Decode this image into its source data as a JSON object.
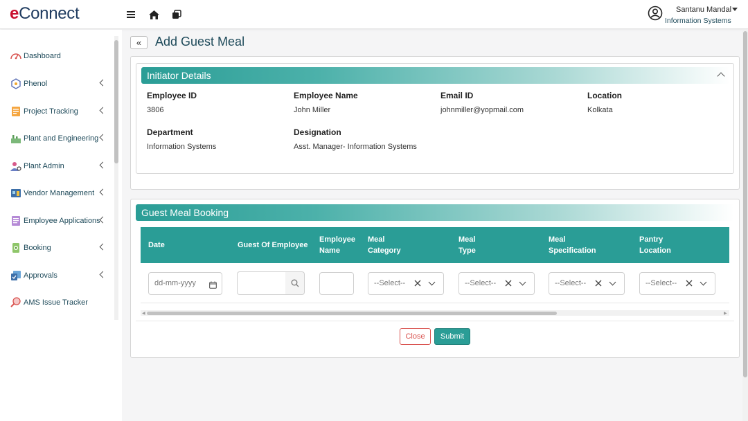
{
  "app": {
    "logo_e": "e",
    "logo_rest": "Connect"
  },
  "header": {
    "user_name": "Santanu Mandal",
    "user_dept": "Information Systems",
    "icons": [
      "menu-icon",
      "home-icon",
      "apps-icon",
      "user-circle-icon"
    ]
  },
  "sidebar": {
    "items": [
      {
        "label": "Dashboard",
        "icon": "dashboard-icon",
        "expandable": false
      },
      {
        "label": "Phenol",
        "icon": "phenol-icon",
        "expandable": true
      },
      {
        "label": "Project Tracking",
        "icon": "project-icon",
        "expandable": true
      },
      {
        "label": "Plant and Engineering",
        "icon": "plant-icon",
        "expandable": true
      },
      {
        "label": "Plant Admin",
        "icon": "admin-icon",
        "expandable": true
      },
      {
        "label": "Vendor Management",
        "icon": "vendor-icon",
        "expandable": true
      },
      {
        "label": "Employee Applications",
        "icon": "employee-apps-icon",
        "expandable": true
      },
      {
        "label": "Booking",
        "icon": "booking-icon",
        "expandable": true
      },
      {
        "label": "Approvals",
        "icon": "approvals-icon",
        "expandable": true
      },
      {
        "label": "AMS Issue Tracker",
        "icon": "issue-tracker-icon",
        "expandable": false
      }
    ]
  },
  "page": {
    "title": "Add Guest Meal",
    "back_label": "«"
  },
  "initiator": {
    "title": "Initiator Details",
    "fields": [
      {
        "label": "Employee ID",
        "value": "3806"
      },
      {
        "label": "Employee Name",
        "value": "John Miller"
      },
      {
        "label": "Email ID",
        "value": "johnmiller@yopmail.com"
      },
      {
        "label": "Location",
        "value": "Kolkata"
      },
      {
        "label": "Department",
        "value": "Information Systems"
      },
      {
        "label": "Designation",
        "value": "Asst. Manager- Information Systems"
      }
    ]
  },
  "booking": {
    "title": "Guest Meal Booking",
    "columns": [
      "Date",
      "Guest Of Employee",
      "Employee\nName",
      "Meal\nCategory",
      "Meal\nType",
      "Meal\nSpecification",
      "Pantry\nLocation"
    ],
    "date_placeholder": "dd-mm-yyyy",
    "select_placeholder": "--Select--",
    "close_label": "Close",
    "submit_label": "Submit"
  },
  "colors": {
    "accent": "#2a9d96",
    "danger": "#d9534f",
    "text_dark": "#1e4a5a"
  }
}
